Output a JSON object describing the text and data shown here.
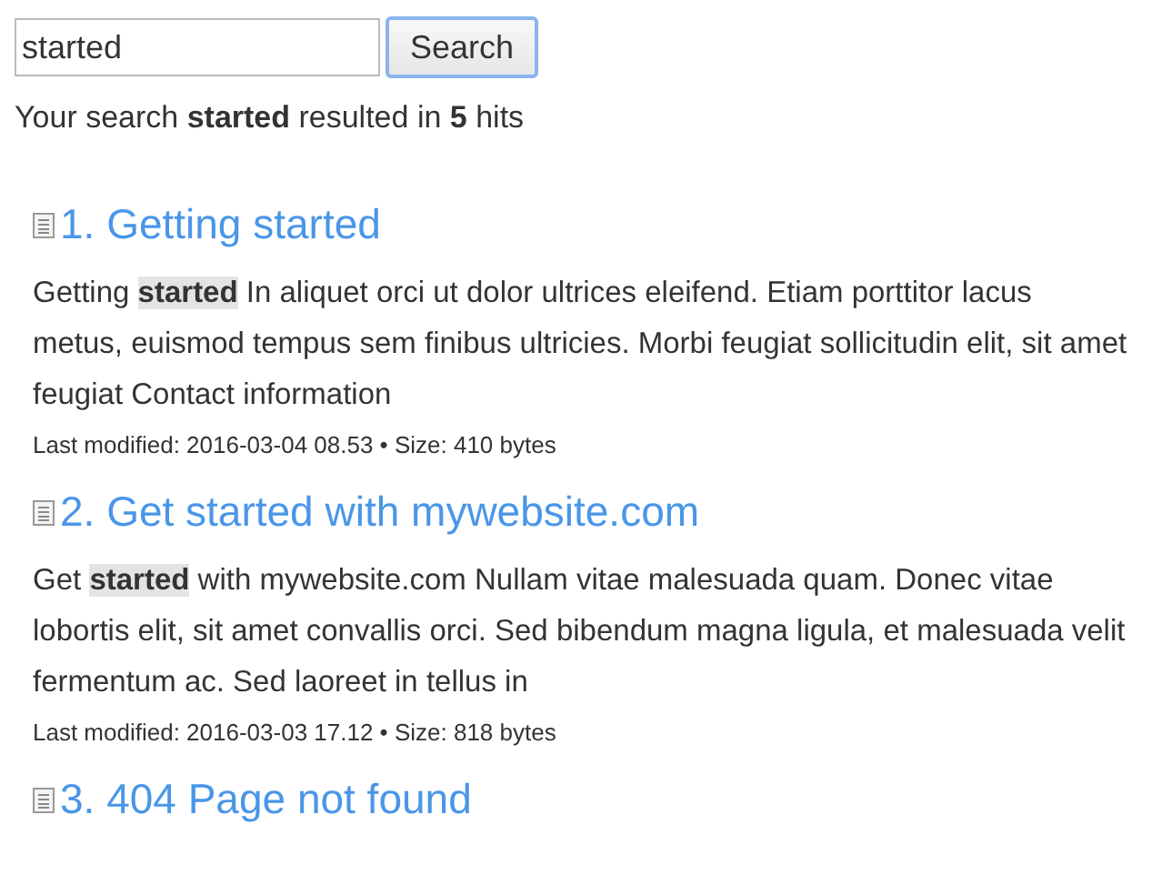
{
  "search": {
    "value": "started",
    "button": "Search"
  },
  "summary": "Your search **started** resulted in **5** hits",
  "results": [
    {
      "title": "1. Getting started",
      "excerpt_before": "Getting ",
      "hit": "started",
      "excerpt_after": " In aliquet orci ut dolor ultrices eleifend. Etiam porttitor lacus metus, euismod tempus sem finibus ultricies. Morbi feugiat sollicitudin elit, sit amet feugiat Contact information",
      "meta": "Last modified: 2016-03-04 08.53 • Size: 410 bytes"
    },
    {
      "title": "2. Get started with mywebsite.com",
      "excerpt_before": "Get ",
      "hit": "started",
      "excerpt_after": " with mywebsite.com Nullam vitae malesuada quam. Donec vitae lobortis elit, sit amet convallis orci. Sed bibendum magna ligula, et malesuada velit fermentum ac. Sed laoreet in tellus in",
      "meta": "Last modified: 2016-03-03 17.12 • Size: 818 bytes"
    },
    {
      "title": "3. 404 Page not found"
    }
  ]
}
